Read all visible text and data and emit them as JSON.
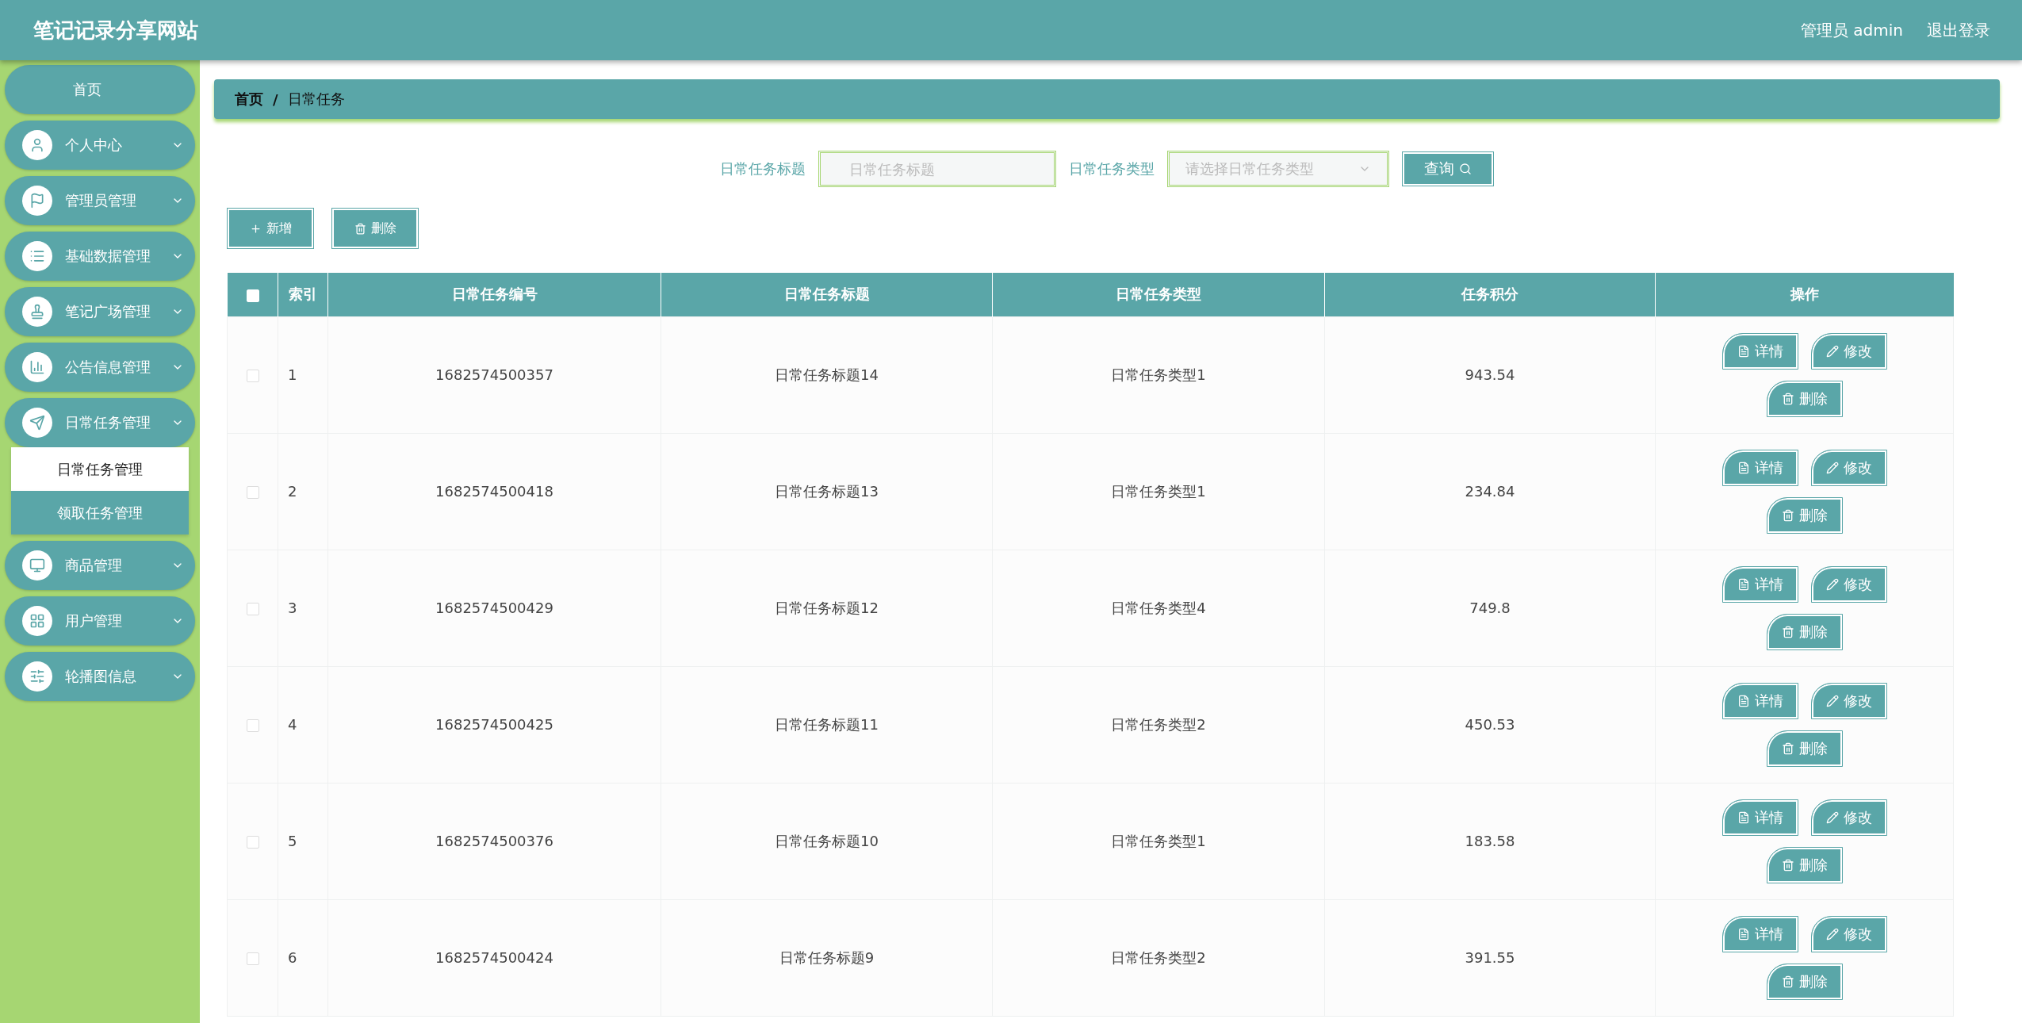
{
  "header": {
    "title": "笔记记录分享网站",
    "user": "管理员 admin",
    "logout": "退出登录"
  },
  "sidebar": {
    "items": [
      {
        "kind": "link",
        "label": "首页"
      },
      {
        "kind": "menu",
        "label": "个人中心"
      },
      {
        "kind": "menu",
        "label": "管理员管理"
      },
      {
        "kind": "menu",
        "label": "基础数据管理"
      },
      {
        "kind": "menu",
        "label": "笔记广场管理"
      },
      {
        "kind": "menu",
        "label": "公告信息管理"
      },
      {
        "kind": "menu",
        "label": "日常任务管理",
        "children": [
          {
            "label": "日常任务管理",
            "selected": true
          },
          {
            "label": "领取任务管理",
            "selected": false
          }
        ]
      },
      {
        "kind": "menu",
        "label": "商品管理"
      },
      {
        "kind": "menu",
        "label": "用户管理"
      },
      {
        "kind": "menu",
        "label": "轮播图信息"
      }
    ]
  },
  "breadcrumb": {
    "items": [
      "首页",
      "日常任务"
    ],
    "separator": "/"
  },
  "search": {
    "title_label": "日常任务标题",
    "title_placeholder": "日常任务标题",
    "type_label": "日常任务类型",
    "type_placeholder": "请选择日常任务类型",
    "button": "查询"
  },
  "actions": [
    "新增",
    "删除"
  ],
  "table": {
    "select_all": false,
    "columns": [
      "索引",
      "日常任务编号",
      "日常任务标题",
      "日常任务类型",
      "任务积分",
      "操作"
    ],
    "rows": [
      {
        "checked": false,
        "cells": [
          "1",
          "1682574500357",
          "日常任务标题14",
          "日常任务类型1",
          "943.54"
        ],
        "buttons": [
          "详情",
          "修改",
          "删除"
        ]
      },
      {
        "checked": false,
        "cells": [
          "2",
          "1682574500418",
          "日常任务标题13",
          "日常任务类型1",
          "234.84"
        ],
        "buttons": [
          "详情",
          "修改",
          "删除"
        ]
      },
      {
        "checked": false,
        "cells": [
          "3",
          "1682574500429",
          "日常任务标题12",
          "日常任务类型4",
          "749.8"
        ],
        "buttons": [
          "详情",
          "修改",
          "删除"
        ]
      },
      {
        "checked": false,
        "cells": [
          "4",
          "1682574500425",
          "日常任务标题11",
          "日常任务类型2",
          "450.53"
        ],
        "buttons": [
          "详情",
          "修改",
          "删除"
        ]
      },
      {
        "checked": false,
        "cells": [
          "5",
          "1682574500376",
          "日常任务标题10",
          "日常任务类型1",
          "183.58"
        ],
        "buttons": [
          "详情",
          "修改",
          "删除"
        ]
      },
      {
        "checked": false,
        "cells": [
          "6",
          "1682574500424",
          "日常任务标题9",
          "日常任务类型2",
          "391.55"
        ],
        "buttons": [
          "详情",
          "修改",
          "删除"
        ]
      }
    ]
  }
}
